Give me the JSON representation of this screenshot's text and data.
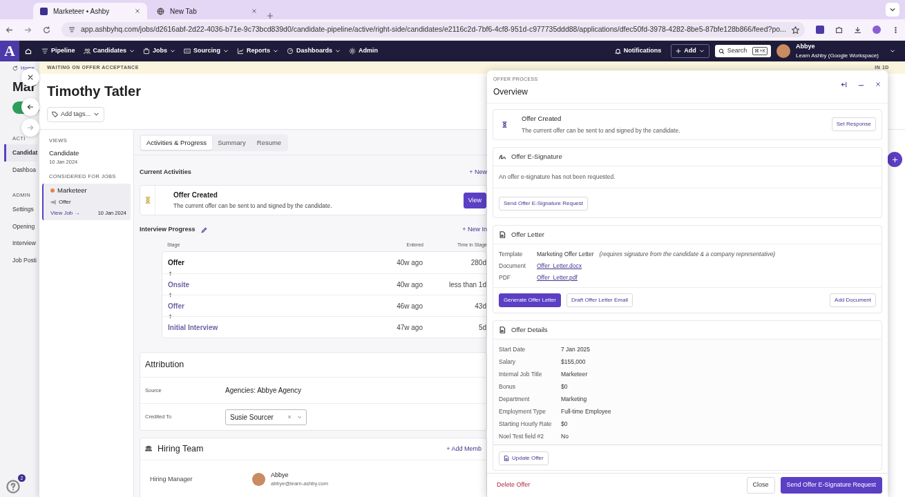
{
  "browser": {
    "tabs": [
      {
        "title": "Marketeer • Ashby",
        "selected": true,
        "kind": "app"
      },
      {
        "title": "New Tab",
        "selected": false,
        "kind": "globe"
      }
    ],
    "url": "app.ashbyhq.com/jobs/d2616abf-2d22-4036-b71e-9c73bcd839d0/candidate-pipeline/active/right-side/candidates/e2116c2d-7bf6-4cf8-951d-c977735ddd88/applications/dfec50fd-3978-4282-8be5-87bfe128b866/feed?po..."
  },
  "navbar": {
    "logo": "A",
    "items": [
      {
        "label": "Pipeline",
        "kind": "pipeline",
        "dropdown": false
      },
      {
        "label": "Candidates",
        "kind": "people",
        "dropdown": true
      },
      {
        "label": "Jobs",
        "kind": "briefcase",
        "dropdown": true
      },
      {
        "label": "Sourcing",
        "kind": "sourcing",
        "dropdown": true
      },
      {
        "label": "Reports",
        "kind": "chart",
        "dropdown": true
      },
      {
        "label": "Dashboards",
        "kind": "dial",
        "dropdown": true
      },
      {
        "label": "Admin",
        "kind": "gear",
        "dropdown": false
      }
    ],
    "notifications": "Notifications",
    "add": "Add",
    "search": "Search",
    "search_shortcut": "⌘+K",
    "user": {
      "name": "Abbye",
      "org": "Learn Ashby (Google Workspace)"
    }
  },
  "background_page": {
    "breadcrumb": "Home",
    "title": "Mar",
    "sections": [
      {
        "heading": "ACTI",
        "items": [
          {
            "label": "Candidat",
            "selected": true
          },
          {
            "label": "Dashboa",
            "selected": false
          }
        ]
      },
      {
        "heading": "ADMIN",
        "items": [
          {
            "label": "Settings",
            "selected": false
          },
          {
            "label": "Opening",
            "selected": false
          },
          {
            "label": "Interview",
            "selected": false
          },
          {
            "label": "Job Posti",
            "selected": false
          }
        ]
      }
    ],
    "help_badge": "2"
  },
  "drawer": {
    "banner": "WAITING ON OFFER ACCEPTANCE",
    "banner_right": "IN 1D",
    "candidate_name": "Timothy Tatler",
    "tags_button": "Add tags...",
    "views_heading": "VIEWS",
    "views": [
      {
        "label": "Candidate",
        "date": "10 Jan 2024"
      }
    ],
    "jobs_heading": "CONSIDERED FOR JOBS",
    "jobs": [
      {
        "title": "Marketeer",
        "color": "#e8834a",
        "stage": "Offer",
        "link": "View Job →",
        "date": "10 Jan 2024",
        "selected": true
      }
    ],
    "tabs": [
      {
        "label": "Activities & Progress",
        "selected": true
      },
      {
        "label": "Summary",
        "selected": false
      },
      {
        "label": "Resume",
        "selected": false
      }
    ],
    "current_activities": {
      "heading": "Current Activities",
      "new_link": "+ New",
      "activity": {
        "title": "Offer Created",
        "text": "The current offer can be sent to and signed by the candidate.",
        "button": "View"
      }
    },
    "interview_progress": {
      "heading": "Interview Progress",
      "new_link": "+ New In",
      "columns": [
        "Stage",
        "Entered",
        "Time in Stage"
      ],
      "rows": [
        {
          "stage": "Offer",
          "entered": "40w ago",
          "time": "280d",
          "current": true
        },
        {
          "stage": "Onsite",
          "entered": "40w ago",
          "time": "less than 1d",
          "current": false
        },
        {
          "stage": "Offer",
          "entered": "46w ago",
          "time": "43d",
          "current": false
        },
        {
          "stage": "Initial Interview",
          "entered": "47w ago",
          "time": "5d",
          "current": false
        }
      ]
    },
    "attribution": {
      "heading": "Attribution",
      "source_label": "Source",
      "source": "Agencies: Abbye Agency",
      "credited_label": "Credited To",
      "credited": "Susie Sourcer"
    },
    "hiring_team": {
      "heading": "Hiring Team",
      "add_link": "+ Add Memb",
      "members": [
        {
          "role": "Hiring Manager",
          "name": "Abbye",
          "email": "abbye@learn-ashby.com"
        }
      ]
    }
  },
  "offer_panel": {
    "eyebrow": "OFFER PROCESS",
    "title": "Overview",
    "status": {
      "title": "Offer Created",
      "text": "The current offer can be sent to and signed by the candidate.",
      "button": "Set Response"
    },
    "esignature": {
      "heading": "Offer E-Signature",
      "text": "An offer e-signature has not been requested.",
      "button": "Send Offer E-Signature Request"
    },
    "letter": {
      "heading": "Offer Letter",
      "fields": [
        {
          "label": "Template",
          "value": "Marketing Offer Letter",
          "note": "(requires signature from the candidate & a company representative)",
          "kind": "text"
        },
        {
          "label": "Document",
          "value": "Offer_Letter.docx",
          "kind": "link"
        },
        {
          "label": "PDF",
          "value": "Offer_Letter.pdf",
          "kind": "link"
        }
      ],
      "buttons": [
        {
          "label": "Generate Offer Letter",
          "primary": true
        },
        {
          "label": "Draft Offer Letter Email",
          "primary": false
        }
      ],
      "add_button": "Add Document"
    },
    "details": {
      "heading": "Offer Details",
      "fields": [
        {
          "label": "Start Date",
          "value": "7 Jan 2025"
        },
        {
          "label": "Salary",
          "value": "$155,000"
        },
        {
          "label": "Internal Job Title",
          "value": "Marketeer"
        },
        {
          "label": "Bonus",
          "value": "$0"
        },
        {
          "label": "Department",
          "value": "Marketing"
        },
        {
          "label": "Employment Type",
          "value": "Full-time Employee"
        },
        {
          "label": "Starting Hourly Rate",
          "value": "$0"
        },
        {
          "label": "Noel Test field #2",
          "value": "No"
        }
      ],
      "button": "Update Offer"
    },
    "footer": {
      "delete": "Delete Offer",
      "close": "Close",
      "send": "Send Offer E-Signature Request"
    }
  }
}
